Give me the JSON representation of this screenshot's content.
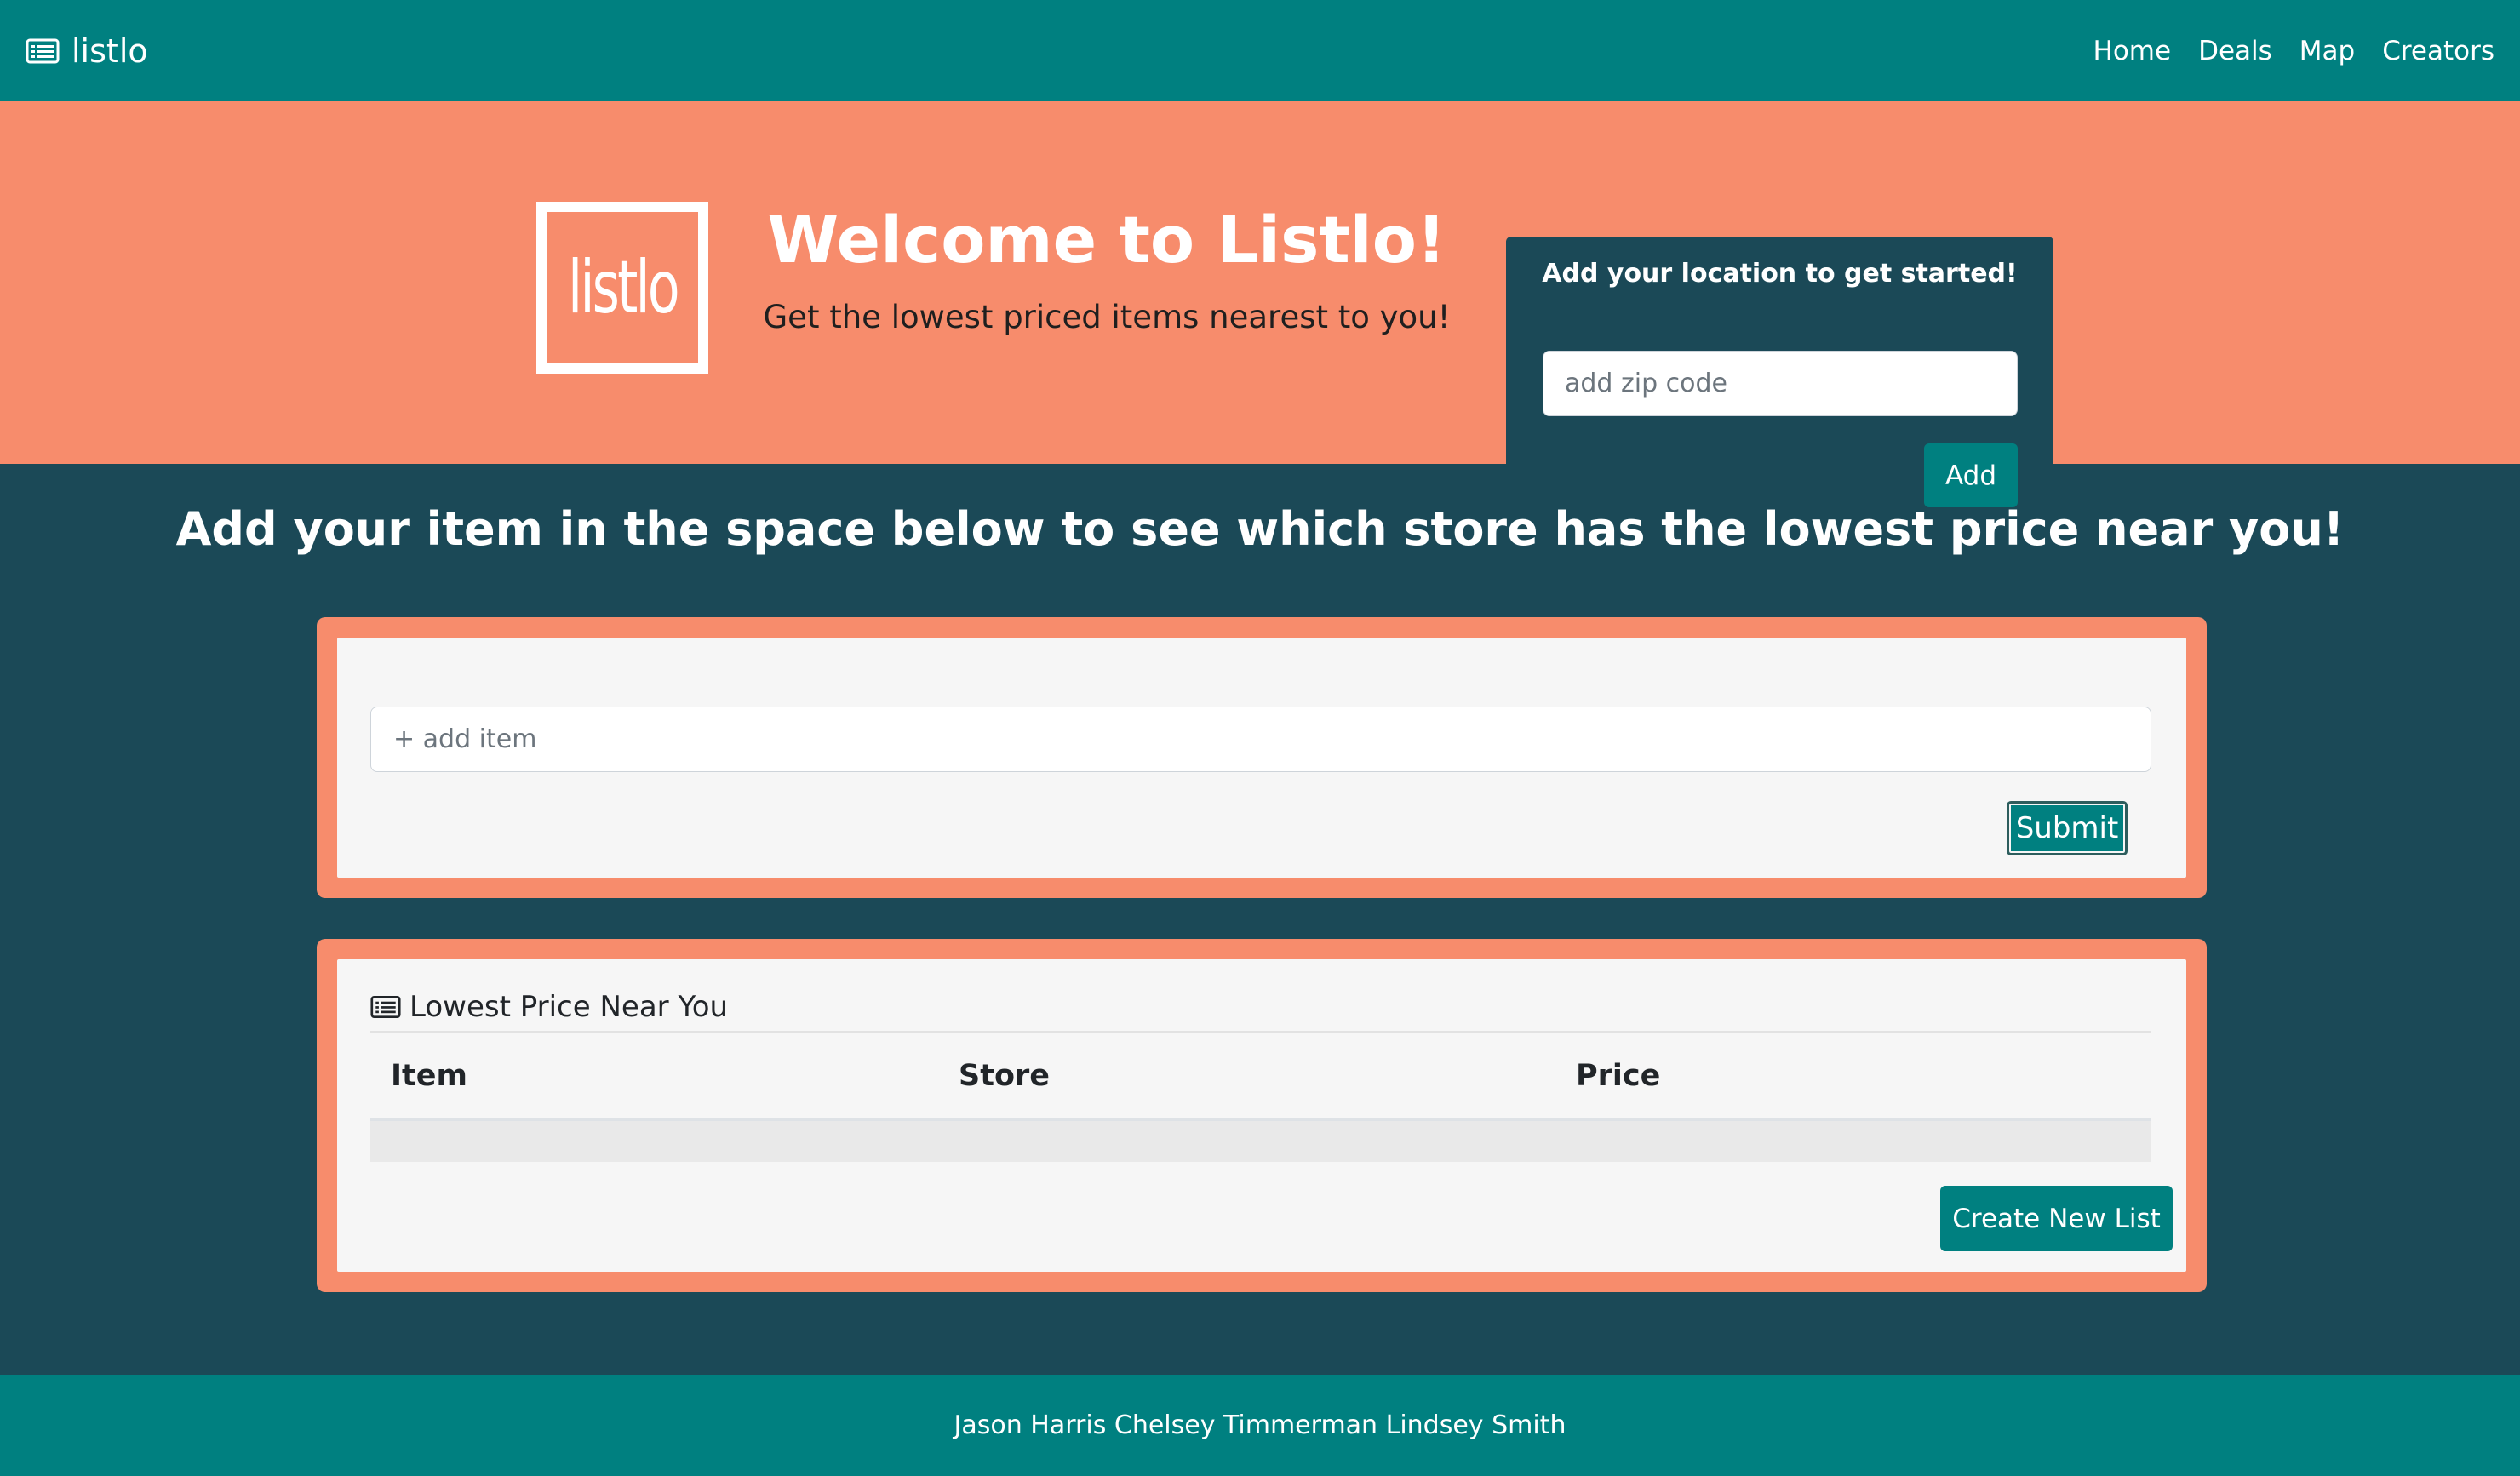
{
  "navbar": {
    "brand": "listlo",
    "brand_icon": "list-icon",
    "links": [
      "Home",
      "Deals",
      "Map",
      "Creators"
    ]
  },
  "hero": {
    "logo_text": "listlo",
    "title": "Welcome to Listlo!",
    "subtitle": "Get the lowest priced items nearest to you!",
    "location_card": {
      "title": "Add your location to get started!",
      "zip_placeholder": "add zip code",
      "add_label": "Add"
    }
  },
  "main": {
    "heading": "Add your item in the space below to see which store has the lowest price near you!",
    "item_form": {
      "item_placeholder": "+ add item",
      "submit_label": "Submit"
    },
    "results": {
      "title": "Lowest Price Near You",
      "title_icon": "list-icon",
      "columns": [
        "Item",
        "Store",
        "Price"
      ],
      "rows": [],
      "create_label": "Create New List"
    }
  },
  "footer": {
    "creators": "Jason Harris Chelsey Timmerman Lindsey Smith"
  },
  "colors": {
    "teal": "#008080",
    "dark_teal": "#1b4957",
    "salmon": "#f78c6c",
    "panel_bg": "#f6f6f6"
  }
}
